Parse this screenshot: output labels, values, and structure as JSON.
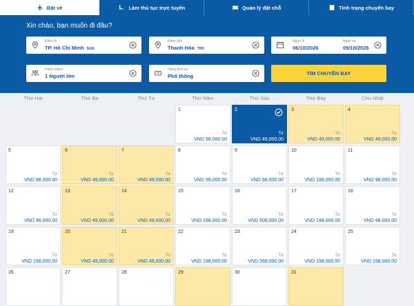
{
  "tabs": [
    {
      "label": "Đặt vé",
      "icon": "plane-icon"
    },
    {
      "label": "Làm thủ tục trực tuyến",
      "icon": "seat-icon"
    },
    {
      "label": "Quản lý đặt chỗ",
      "icon": "ticket-icon"
    },
    {
      "label": "Tình trạng chuyến bay",
      "icon": "status-icon"
    }
  ],
  "search": {
    "greeting": "Xin chào, bạn muốn đi đâu?",
    "origin_label": "Điểm đi",
    "origin_value": "TP. Hồ Chí Minh",
    "origin_code": "SGN",
    "dest_label": "Điểm đến",
    "dest_value": "Thanh Hóa",
    "dest_code": "THD",
    "depart_label": "Ngày đi",
    "depart_value": "06/10/2026",
    "return_label": "Ngày về",
    "return_value": "09/10/2026",
    "pax_label": "Hành khách",
    "pax_value": "1 Người lớn",
    "class_label": "Hạng dịch vụ",
    "class_value": "Phổ thông",
    "search_button": "TÌM CHUYẾN BAY"
  },
  "calendar": {
    "weekdays": [
      "Thứ Hai",
      "Thứ Ba",
      "Thứ Tư",
      "Thứ Năm",
      "Thứ Sáu",
      "Thứ Bảy",
      "Chủ Nhật"
    ],
    "from_label": "Từ",
    "currency": "VND",
    "selected_day": 2,
    "days": [
      {
        "day": 1,
        "col": 3,
        "row": 0,
        "price": "98,000.00",
        "cheap": false
      },
      {
        "day": 2,
        "col": 4,
        "row": 0,
        "price": "49,000.00",
        "cheap": false
      },
      {
        "day": 3,
        "col": 5,
        "row": 0,
        "price": "49,000.00",
        "cheap": true
      },
      {
        "day": 4,
        "col": 6,
        "row": 0,
        "price": "49,000.00",
        "cheap": true
      },
      {
        "day": 5,
        "col": 0,
        "row": 1,
        "price": "98,000.00",
        "cheap": false
      },
      {
        "day": 6,
        "col": 1,
        "row": 1,
        "price": "49,000.00",
        "cheap": true
      },
      {
        "day": 7,
        "col": 2,
        "row": 1,
        "price": "49,000.00",
        "cheap": true
      },
      {
        "day": 8,
        "col": 3,
        "row": 1,
        "price": "98,000.00",
        "cheap": false
      },
      {
        "day": 9,
        "col": 4,
        "row": 1,
        "price": "98,000.00",
        "cheap": false
      },
      {
        "day": 10,
        "col": 5,
        "row": 1,
        "price": "198,000.00",
        "cheap": false
      },
      {
        "day": 11,
        "col": 6,
        "row": 1,
        "price": "98,000.00",
        "cheap": false
      },
      {
        "day": 12,
        "col": 0,
        "row": 2,
        "price": "98,000.00",
        "cheap": false
      },
      {
        "day": 13,
        "col": 1,
        "row": 2,
        "price": "49,000.00",
        "cheap": true
      },
      {
        "day": 14,
        "col": 2,
        "row": 2,
        "price": "49,000.00",
        "cheap": true
      },
      {
        "day": 15,
        "col": 3,
        "row": 2,
        "price": "198,000.00",
        "cheap": false
      },
      {
        "day": 16,
        "col": 4,
        "row": 2,
        "price": "508,000.00",
        "cheap": false
      },
      {
        "day": 17,
        "col": 5,
        "row": 2,
        "price": "198,000.00",
        "cheap": false
      },
      {
        "day": 18,
        "col": 6,
        "row": 2,
        "price": "98,000.00",
        "cheap": false
      },
      {
        "day": 19,
        "col": 0,
        "row": 3,
        "price": "198,000.00",
        "cheap": false
      },
      {
        "day": 20,
        "col": 1,
        "row": 3,
        "price": "49,000.00",
        "cheap": true
      },
      {
        "day": 21,
        "col": 2,
        "row": 3,
        "price": "49,000.00",
        "cheap": true
      },
      {
        "day": 22,
        "col": 3,
        "row": 3,
        "price": "198,000.00",
        "cheap": false
      },
      {
        "day": 23,
        "col": 4,
        "row": 3,
        "price": "368,000.00",
        "cheap": false
      },
      {
        "day": 24,
        "col": 5,
        "row": 3,
        "price": "198,000.00",
        "cheap": false
      },
      {
        "day": 25,
        "col": 6,
        "row": 3,
        "price": "198,000.00",
        "cheap": false
      },
      {
        "day": 26,
        "col": 0,
        "row": 4,
        "price": "",
        "cheap": false
      },
      {
        "day": 27,
        "col": 1,
        "row": 4,
        "price": "",
        "cheap": false
      },
      {
        "day": 28,
        "col": 2,
        "row": 4,
        "price": "",
        "cheap": false
      },
      {
        "day": 29,
        "col": 3,
        "row": 4,
        "price": "",
        "cheap": true
      },
      {
        "day": 30,
        "col": 4,
        "row": 4,
        "price": "",
        "cheap": false
      },
      {
        "day": 31,
        "col": 5,
        "row": 4,
        "price": "",
        "cheap": true
      }
    ]
  },
  "colors": {
    "brand": "#0b5aa6",
    "accent": "#ffd33a",
    "cheap": "#fce9a7"
  }
}
